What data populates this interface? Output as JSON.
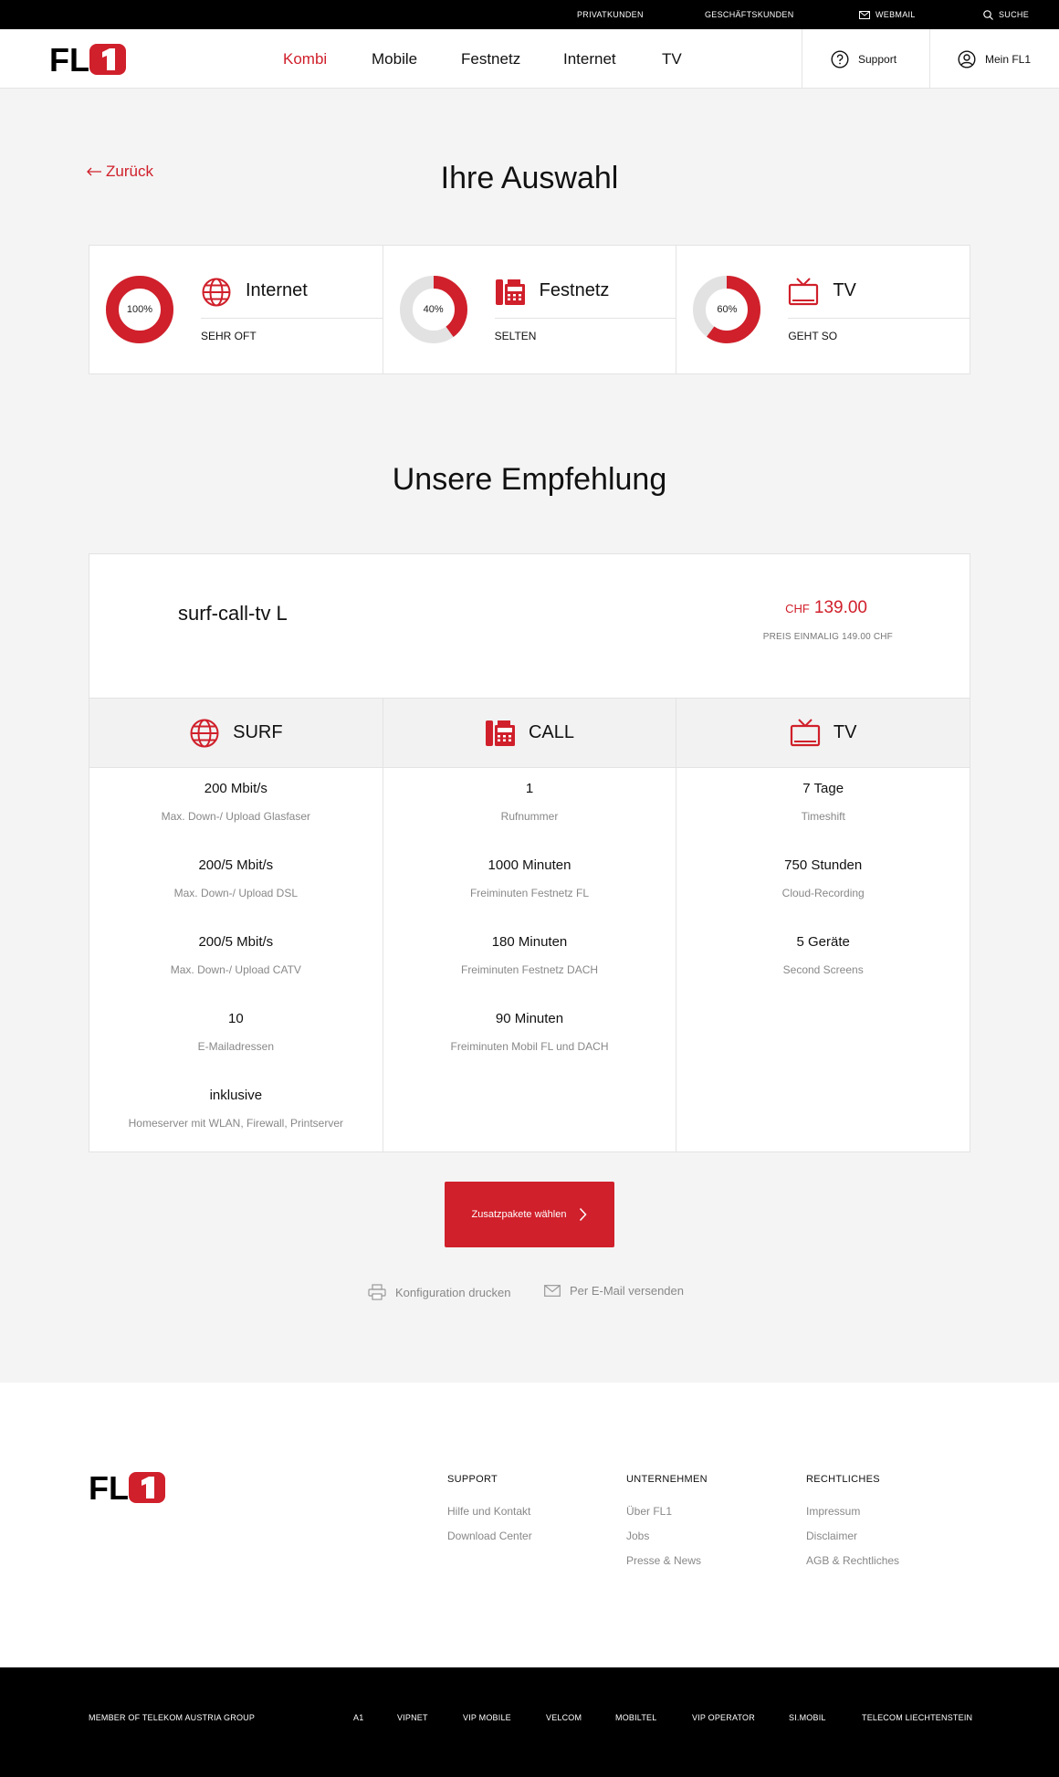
{
  "topbar": {
    "privatkunden": "PRIVATKUNDEN",
    "geschaeftskunden": "GESCHÄFTSKUNDEN",
    "webmail": "WEBMAIL",
    "suche": "SUCHE"
  },
  "brand": {
    "logo_text": "FL1",
    "red": "#d0202b"
  },
  "nav": {
    "items": [
      {
        "label": "Kombi"
      },
      {
        "label": "Mobile"
      },
      {
        "label": "Festnetz"
      },
      {
        "label": "Internet"
      },
      {
        "label": "TV"
      }
    ],
    "support": "Support",
    "mein": "Mein FL1"
  },
  "page": {
    "back": "Zurück",
    "selection_title": "Ihre Auswahl",
    "recommendation_title": "Unsere Empfehlung"
  },
  "selection": [
    {
      "title": "Internet",
      "level": "SEHR OFT",
      "percent_label": "100%",
      "fraction": 1.0,
      "icon": "globe-icon"
    },
    {
      "title": "Festnetz",
      "level": "SELTEN",
      "percent_label": "40%",
      "fraction": 0.4,
      "icon": "phone-icon"
    },
    {
      "title": "TV",
      "level": "GEHT SO",
      "percent_label": "60%",
      "fraction": 0.6,
      "icon": "tv-icon"
    }
  ],
  "recommendation": {
    "name": "surf-call-tv L",
    "currency": "CHF",
    "price": "139.00",
    "once": "PREIS EINMALIG 149.00 CHF",
    "tabs": [
      {
        "label": "SURF",
        "icon": "globe-icon"
      },
      {
        "label": "CALL",
        "icon": "phone-icon"
      },
      {
        "label": "TV",
        "icon": "tv-icon"
      }
    ],
    "surf": [
      {
        "value": "200 Mbit/s",
        "label": "Max. Down-/ Upload Glasfaser"
      },
      {
        "value": "200/5 Mbit/s",
        "label": "Max. Down-/ Upload DSL"
      },
      {
        "value": "200/5 Mbit/s",
        "label": "Max. Down-/ Upload CATV"
      },
      {
        "value": "10",
        "label": "E-Mailadressen"
      },
      {
        "value": "inklusive",
        "label": "Homeserver mit WLAN, Firewall, Printserver"
      }
    ],
    "call": [
      {
        "value": "1",
        "label": "Rufnummer"
      },
      {
        "value": "1000 Minuten",
        "label": "Freiminuten Festnetz FL"
      },
      {
        "value": "180 Minuten",
        "label": "Freiminuten Festnetz DACH"
      },
      {
        "value": "90 Minuten",
        "label": "Freiminuten Mobil FL und DACH"
      }
    ],
    "tv": [
      {
        "value": "7 Tage",
        "label": "Timeshift"
      },
      {
        "value": "750 Stunden",
        "label": "Cloud-Recording"
      },
      {
        "value": "5 Geräte",
        "label": "Second Screens"
      }
    ]
  },
  "cta": {
    "label": "Zusatzpakete wählen"
  },
  "actions": {
    "print": "Konfiguration drucken",
    "email": "Per E-Mail versenden"
  },
  "footer": {
    "support": {
      "head": "SUPPORT",
      "links": [
        "Hilfe und Kontakt",
        "Download Center"
      ]
    },
    "company": {
      "head": "UNTERNEHMEN",
      "links": [
        "Über FL1",
        "Jobs",
        "Presse & News"
      ]
    },
    "legal": {
      "head": "RECHTLICHES",
      "links": [
        "Impressum",
        "Disclaimer",
        "AGB & Rechtliches"
      ]
    }
  },
  "bottombar": {
    "member": "MEMBER OF TELEKOM AUSTRIA GROUP",
    "links": [
      "A1",
      "VIPNET",
      "VIP MOBILE",
      "VELCOM",
      "MOBILTEL",
      "VIP OPERATOR",
      "SI.MOBIL",
      "TELECOM LIECHTENSTEIN"
    ]
  }
}
